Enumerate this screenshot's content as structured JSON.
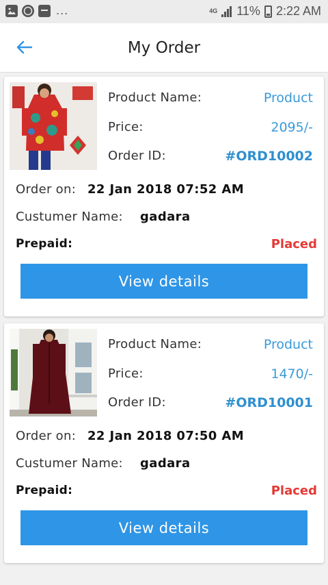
{
  "status_bar": {
    "left_icons": [
      "gallery-icon",
      "whatsapp-icon",
      "message-icon"
    ],
    "more": "...",
    "network": "4G",
    "battery_percent": "11%",
    "time": "2:22 AM"
  },
  "header": {
    "back_icon": "arrow-left-icon",
    "title": "My Order"
  },
  "colors": {
    "accent": "#2f95e6",
    "value_blue": "#3a9ad9",
    "status_red": "#e53935"
  },
  "orders": [
    {
      "product_label": "Product Name:",
      "product_value": "Product",
      "price_label": "Price:",
      "price_value": "2095/-",
      "orderid_label": "Order ID:",
      "orderid_value": "#ORD10002",
      "order_on_label": "Order on:",
      "order_on_value": "22 Jan 2018 07:52 AM",
      "customer_label": "Custumer Name:",
      "customer_value": "gadara",
      "payment_label": "Prepaid:",
      "status": "Placed",
      "button_label": "View details"
    },
    {
      "product_label": "Product Name:",
      "product_value": "Product",
      "price_label": "Price:",
      "price_value": "1470/-",
      "orderid_label": "Order ID:",
      "orderid_value": "#ORD10001",
      "order_on_label": "Order on:",
      "order_on_value": "22 Jan 2018 07:50 AM",
      "customer_label": "Custumer Name:",
      "customer_value": "gadara",
      "payment_label": "Prepaid:",
      "status": "Placed",
      "button_label": "View details"
    }
  ]
}
